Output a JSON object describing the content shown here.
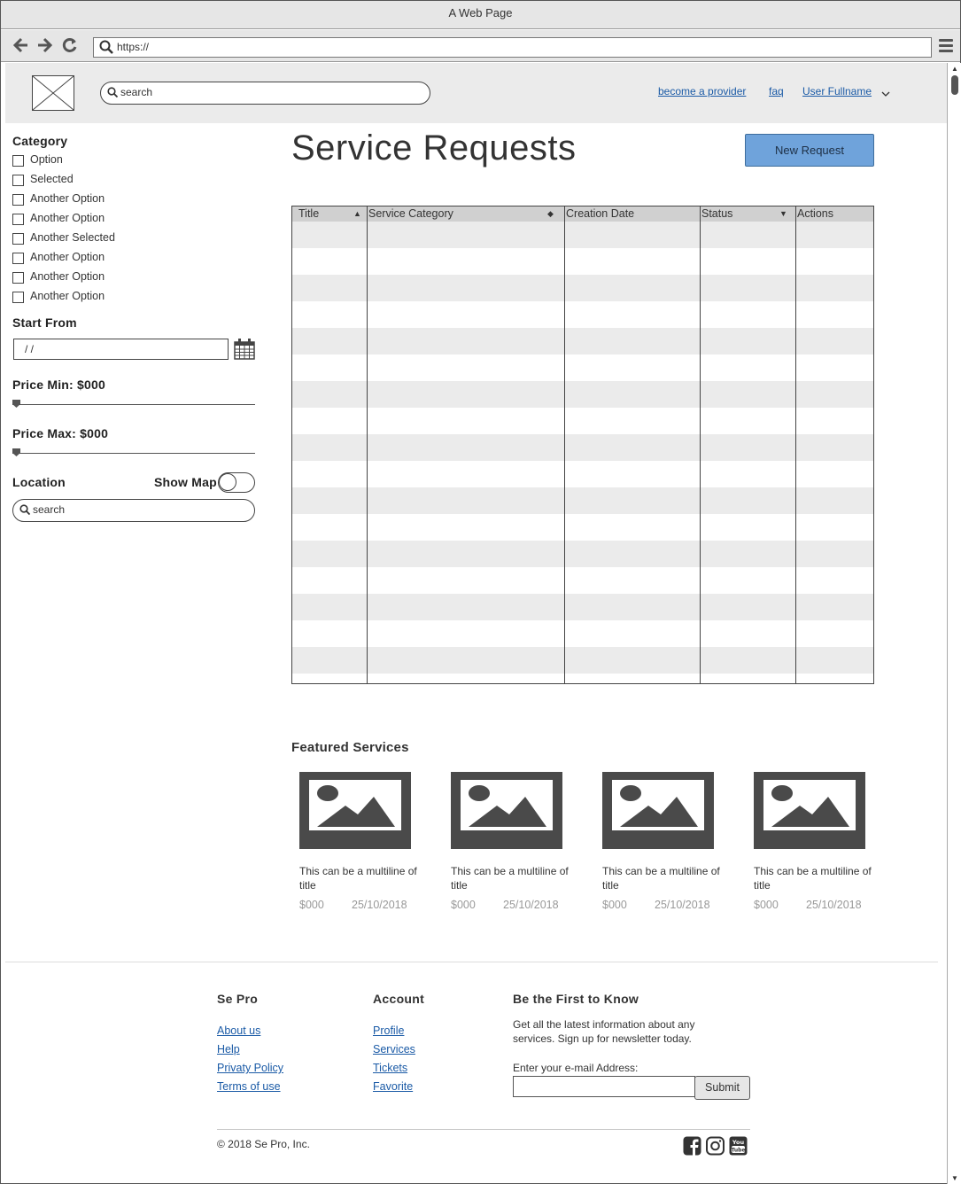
{
  "browser": {
    "window_title": "A Web Page",
    "url": "https://"
  },
  "header": {
    "search_placeholder": "search",
    "links": {
      "provider": "become a provider",
      "faq": "faq",
      "user": "User Fullname"
    }
  },
  "sidebar": {
    "category_heading": "Category",
    "options": [
      {
        "label": "Option",
        "checked": false
      },
      {
        "label": "Selected",
        "checked": false
      },
      {
        "label": "Another Option",
        "checked": false
      },
      {
        "label": "Another Option",
        "checked": false
      },
      {
        "label": "Another Selected",
        "checked": false
      },
      {
        "label": "Another Option",
        "checked": false
      },
      {
        "label": "Another Option",
        "checked": false
      },
      {
        "label": "Another Option",
        "checked": false
      }
    ],
    "start_from_heading": "Start From",
    "date_value": "/ /",
    "price_min_label": "Price Min: $000",
    "price_max_label": "Price Max: $000",
    "location_heading": "Location",
    "show_map_label": "Show Map",
    "location_search_placeholder": "search"
  },
  "main": {
    "title": "Service Requests",
    "new_request_label": "New Request",
    "table": {
      "columns": [
        "Title",
        "Service Category",
        "Creation Date",
        "Status",
        "Actions"
      ],
      "sort_indicators": [
        "▲",
        "◆",
        "",
        "▼",
        ""
      ],
      "rows": [
        [],
        [],
        [],
        [],
        [],
        [],
        [],
        [],
        [],
        [],
        [],
        [],
        [],
        [],
        [],
        [],
        [],
        []
      ]
    }
  },
  "featured": {
    "heading": "Featured Services",
    "cards": [
      {
        "title": "This can be a multiline of title",
        "price": "$000",
        "date": "25/10/2018"
      },
      {
        "title": "This can be a multiline of title",
        "price": "$000",
        "date": "25/10/2018"
      },
      {
        "title": "This can be a multiline of title",
        "price": "$000",
        "date": "25/10/2018"
      },
      {
        "title": "This can be a multiline of title",
        "price": "$000",
        "date": "25/10/2018"
      }
    ]
  },
  "footer": {
    "col1": {
      "heading": "Se Pro",
      "links": [
        "About us",
        "Help",
        "Privaty Policy",
        "Terms of use"
      ]
    },
    "col2": {
      "heading": "Account",
      "links": [
        "Profile",
        "Services",
        "Tickets",
        "Favorite"
      ]
    },
    "newsletter": {
      "heading": "Be the First to Know",
      "text": "Get all the latest information about any services. Sign up for newsletter today.",
      "email_label": "Enter your e-mail Address:",
      "submit_label": "Submit"
    },
    "copyright": "© 2018 Se Pro, Inc.",
    "social_icons": [
      "facebook-icon",
      "instagram-icon",
      "youtube-icon"
    ],
    "youtube_logo_text": "You Tube"
  },
  "colors": {
    "accent_button": "#6fa3db",
    "link": "#1a5aa6",
    "header_bg": "#ebebeb",
    "image_placeholder": "#4a4a4a"
  }
}
